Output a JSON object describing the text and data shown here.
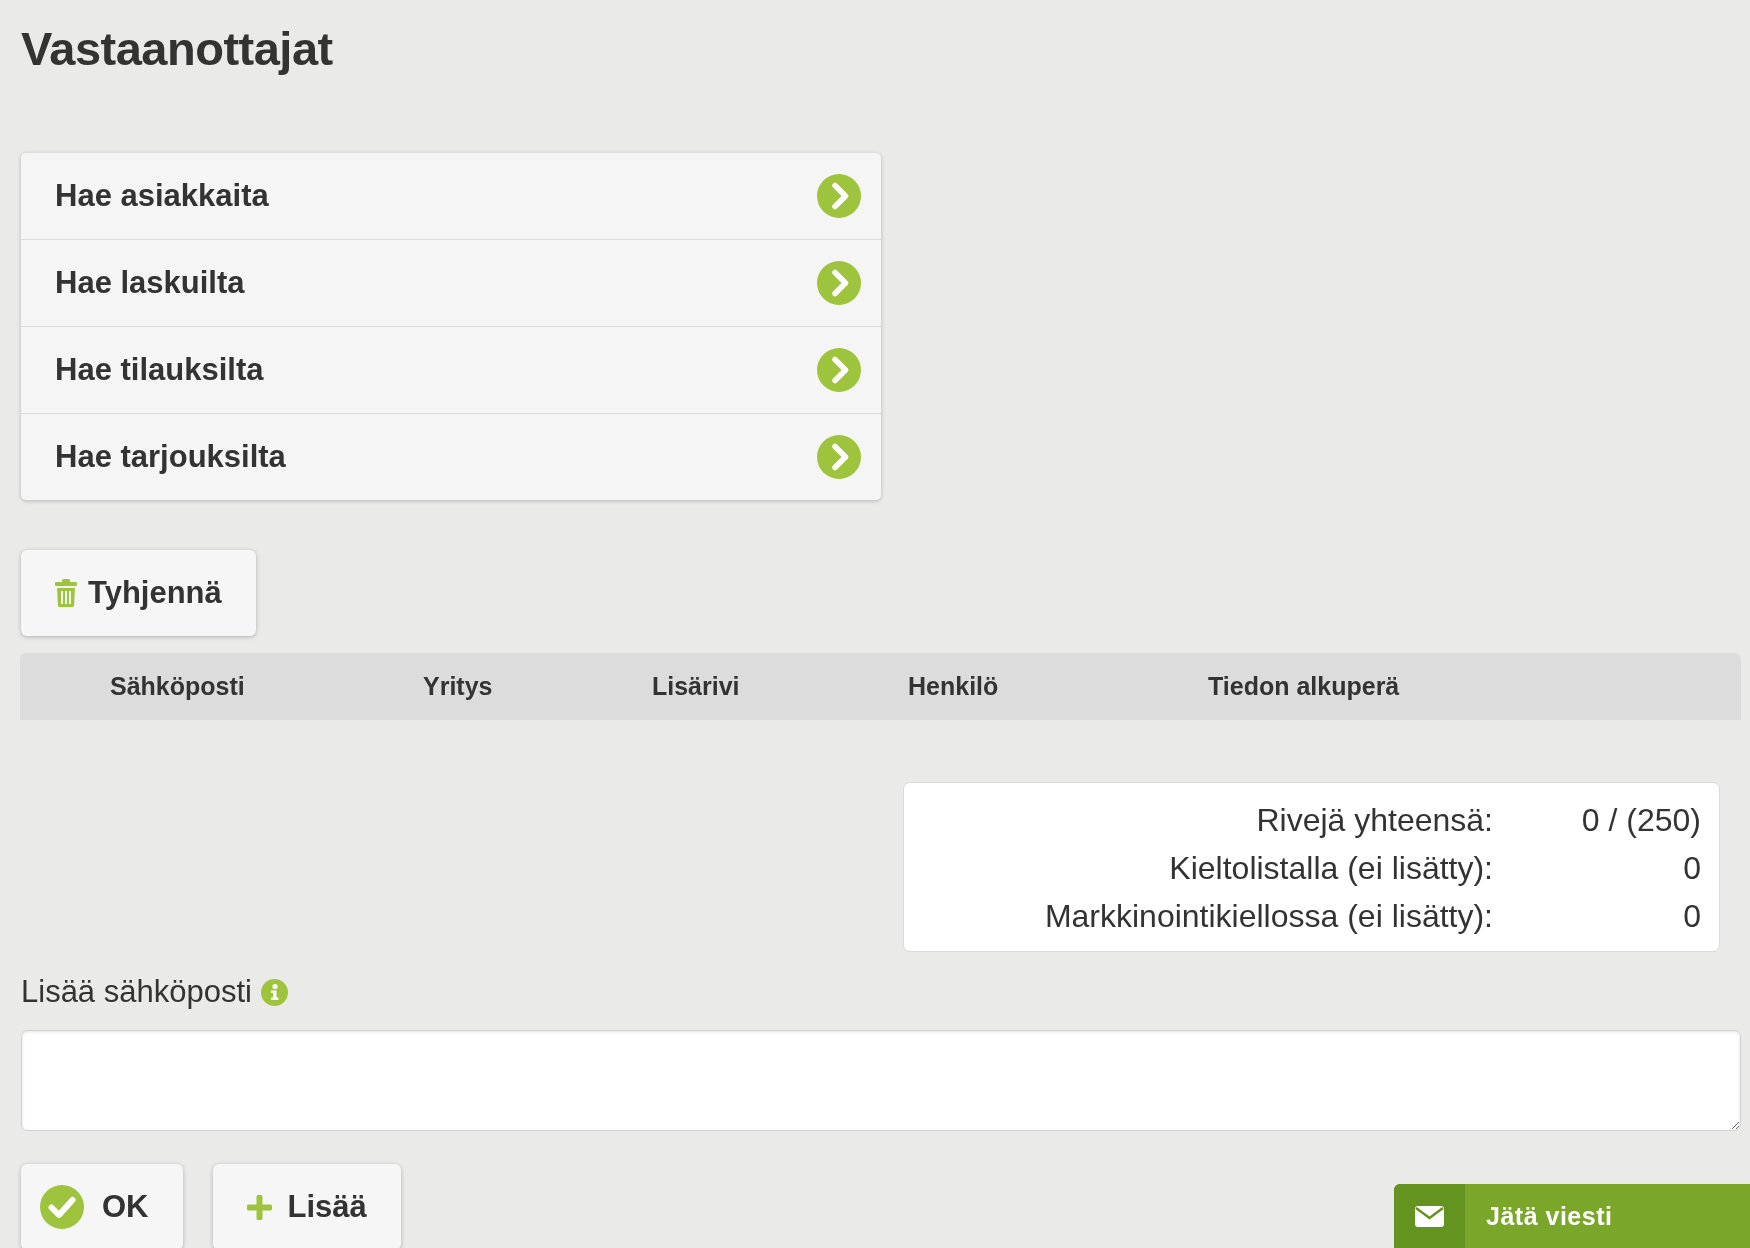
{
  "page": {
    "title": "Vastaanottajat"
  },
  "search_menu": [
    {
      "label": "Hae asiakkaita"
    },
    {
      "label": "Hae laskuilta"
    },
    {
      "label": "Hae tilauksilta"
    },
    {
      "label": "Hae tarjouksilta"
    }
  ],
  "clear_button": {
    "kind": "clear",
    "label": "Tyhjennä"
  },
  "table": {
    "columns": [
      "Sähköposti",
      "Yritys",
      "Lisärivi",
      "Henkilö",
      "Tiedon alkuperä"
    ]
  },
  "summary": [
    {
      "label": "Rivejä yhteensä:",
      "value": "0 / (250)"
    },
    {
      "label": "Kieltolistalla (ei lisätty):",
      "value": "0"
    },
    {
      "label": "Markkinointikiellossa (ei lisätty):",
      "value": "0"
    }
  ],
  "add_email": {
    "label": "Lisää sähköposti"
  },
  "buttons": [
    {
      "kind": "ok",
      "label": "OK"
    },
    {
      "kind": "add",
      "label": "Lisää"
    }
  ],
  "feedback_tab": {
    "label": "Jätä viesti"
  }
}
